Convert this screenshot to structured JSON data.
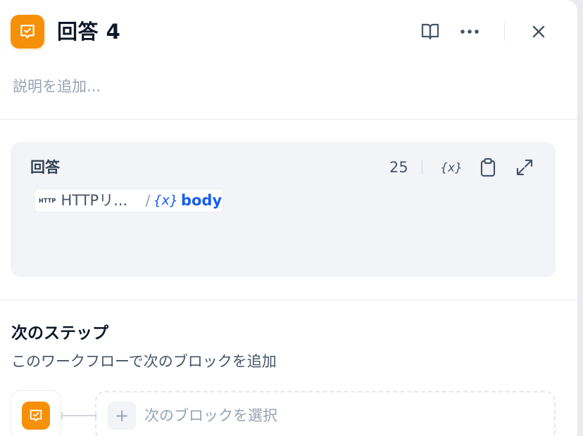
{
  "header": {
    "title": "回答 4",
    "description_placeholder": "説明を追加...",
    "icons": [
      "answer-block-icon",
      "book-open-icon",
      "more-horizontal-icon",
      "close-icon"
    ]
  },
  "answer": {
    "label": "回答",
    "char_count": "25",
    "tools": [
      "variable-icon",
      "clipboard-icon",
      "expand-icon"
    ],
    "variable": {
      "source_badge": "HTTP",
      "source_name": "HTTPリ...",
      "separator": "/",
      "var_icon": "{x}",
      "var_name": "body"
    }
  },
  "next_step": {
    "title": "次のステップ",
    "subtitle": "このワークフローで次のブロックを追加",
    "select_label": "次のブロックを選択",
    "plus": "+"
  },
  "colors": {
    "accent_orange": "#f79009",
    "link_blue": "#155eef",
    "panel_bg": "#f2f4f7"
  }
}
